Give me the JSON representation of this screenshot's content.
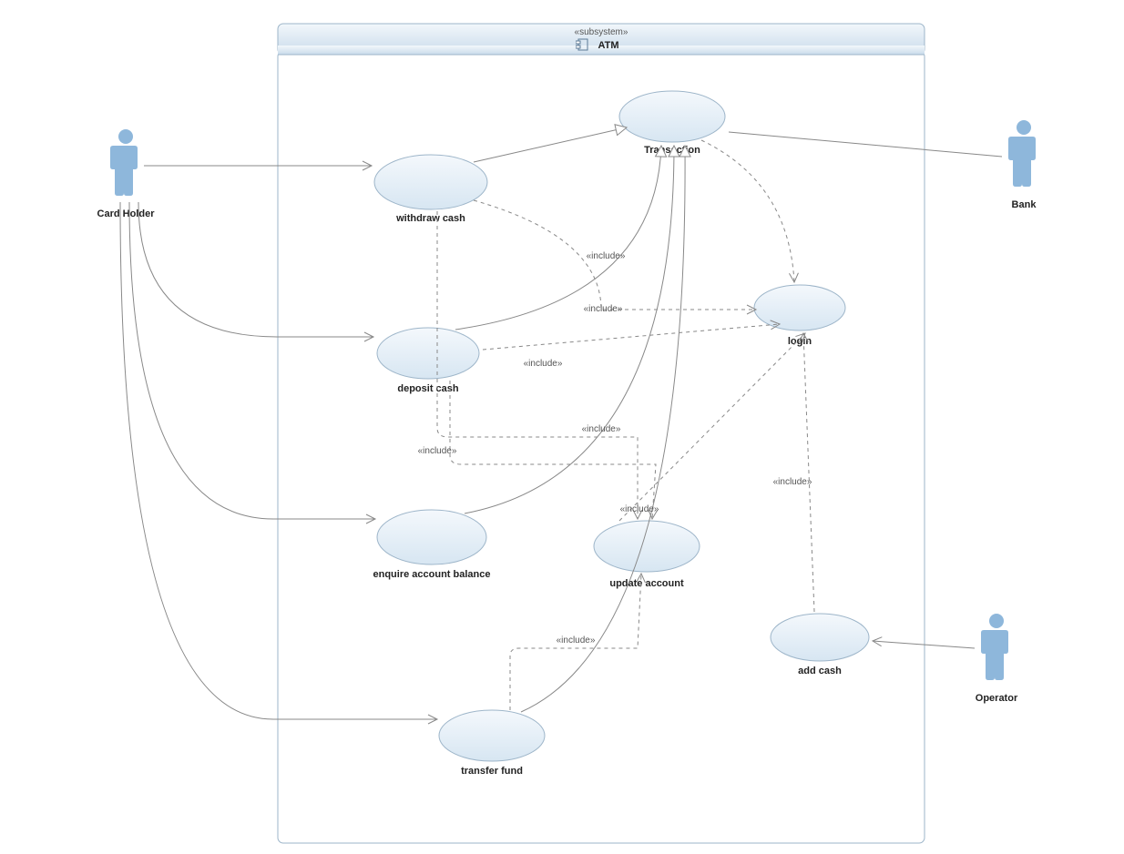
{
  "subsystem": {
    "stereotype": "«subsystem»",
    "name": "ATM"
  },
  "actors": {
    "cardholder": "Card Holder",
    "bank": "Bank",
    "operator": "Operator"
  },
  "usecases": {
    "withdraw": "withdraw cash",
    "deposit": "deposit cash",
    "enquire": "enquire account balance",
    "transfer": "transfer fund",
    "transaction": "Transaction",
    "login": "login",
    "update": "update account",
    "addcash": "add cash"
  },
  "include_label": "«include»"
}
